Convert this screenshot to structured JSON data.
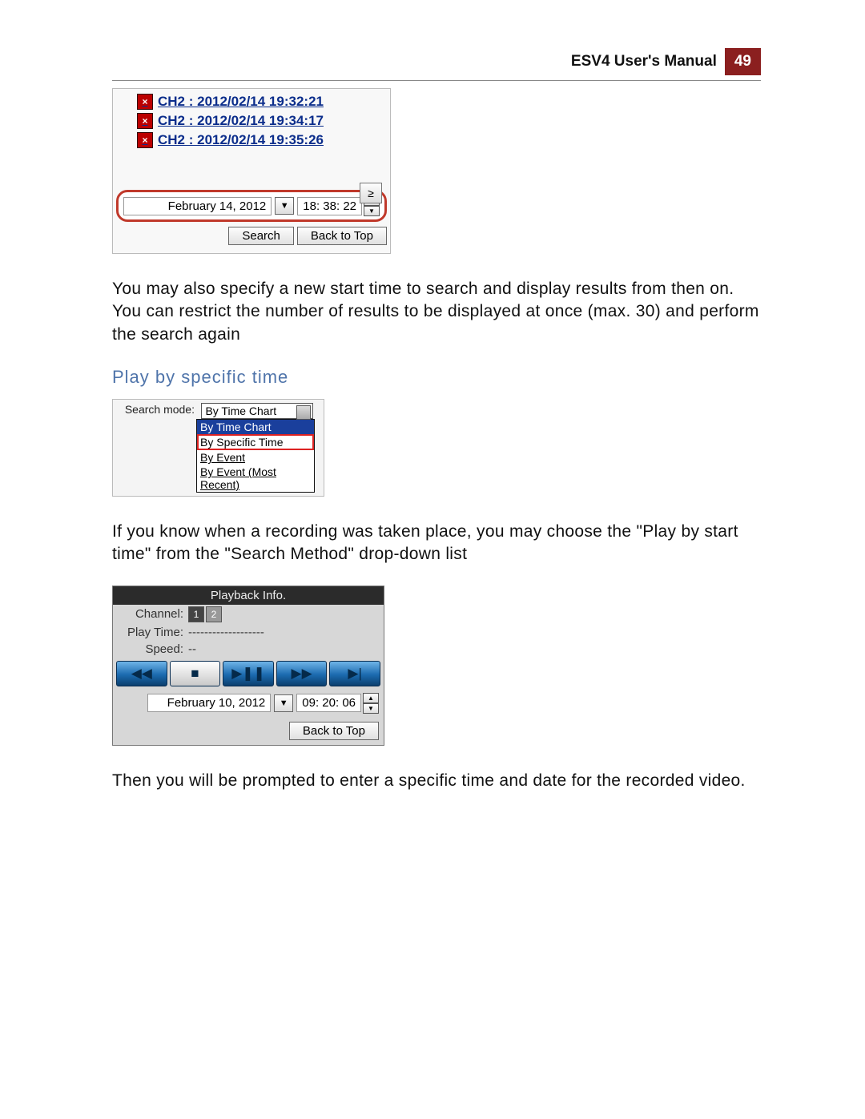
{
  "header": {
    "title": "ESV4 User's Manual",
    "page": "49"
  },
  "eventlist": {
    "items": [
      "CH2 : 2012/02/14 19:32:21",
      "CH2 : 2012/02/14 19:34:17",
      "CH2 : 2012/02/14 19:35:26"
    ],
    "nav_next": "≥",
    "date": "February 14, 2012",
    "time_h": "18",
    "time_m": "38",
    "time_s": "22",
    "buttons": {
      "search": "Search",
      "back": "Back to Top"
    }
  },
  "para1": "You may also specify a new start time to search and display results from then on. You can restrict the number of results to be displayed at once (max. 30) and perform the search again",
  "section_title": "Play by specific time",
  "searchmode": {
    "label": "Search mode:",
    "value": "By Time Chart",
    "options": [
      "By Time Chart",
      "By Specific Time",
      "By Event",
      "By Event (Most Recent)"
    ]
  },
  "para2": "If you know when a recording was taken place, you may choose the \"Play by start time\" from the \"Search Method\" drop-down list",
  "playback": {
    "title": "Playback Info.",
    "channel_label": "Channel:",
    "channels": [
      "1",
      "2"
    ],
    "playtime_label": "Play Time:",
    "playtime_value": "-------------------",
    "speed_label": "Speed:",
    "speed_value": "--",
    "controls": {
      "rewind": "◀◀",
      "stop": "■",
      "playpause": "▶❚❚",
      "forward": "▶▶",
      "next": "▶|"
    },
    "date": "February 10, 2012",
    "time_h": "09",
    "time_m": "20",
    "time_s": "06",
    "back": "Back to Top"
  },
  "para3": "Then you will be prompted to enter a specific time and date for the recorded video."
}
